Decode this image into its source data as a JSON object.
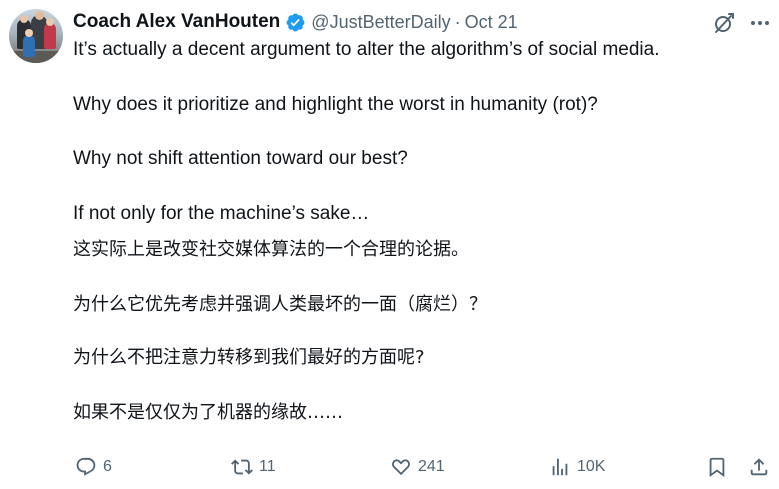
{
  "author": {
    "name": "Coach Alex VanHouten",
    "handle": "@JustBetterDaily",
    "separator": "·",
    "date": "Oct 21",
    "verified_color": "#1d9bf0"
  },
  "post": {
    "en_lines": [
      "It’s actually a decent argument to alter the algorithm’s of social media.",
      "Why does it prioritize and highlight the worst in humanity (rot)?",
      "Why not shift attention toward our best?",
      "If not only for the machine’s sake…"
    ],
    "zh_lines": [
      "这实际上是改变社交媒体算法的一个合理的论据。",
      "为什么它优先考虑并强调人类最坏的一面（腐烂）？",
      "为什么不把注意力转移到我们最好的方面呢?",
      "如果不是仅仅为了机器的缘故……"
    ]
  },
  "actions": {
    "replies": "6",
    "reposts": "11",
    "likes": "241",
    "views": "10K"
  },
  "icons": {
    "grok": "grok-icon",
    "more": "more-icon",
    "reply": "reply-icon",
    "repost": "repost-icon",
    "like": "heart-icon",
    "views": "views-icon",
    "bookmark": "bookmark-icon",
    "share": "share-icon"
  },
  "colors": {
    "text": "#0f1419",
    "secondary": "#536471",
    "verified": "#1d9bf0"
  }
}
